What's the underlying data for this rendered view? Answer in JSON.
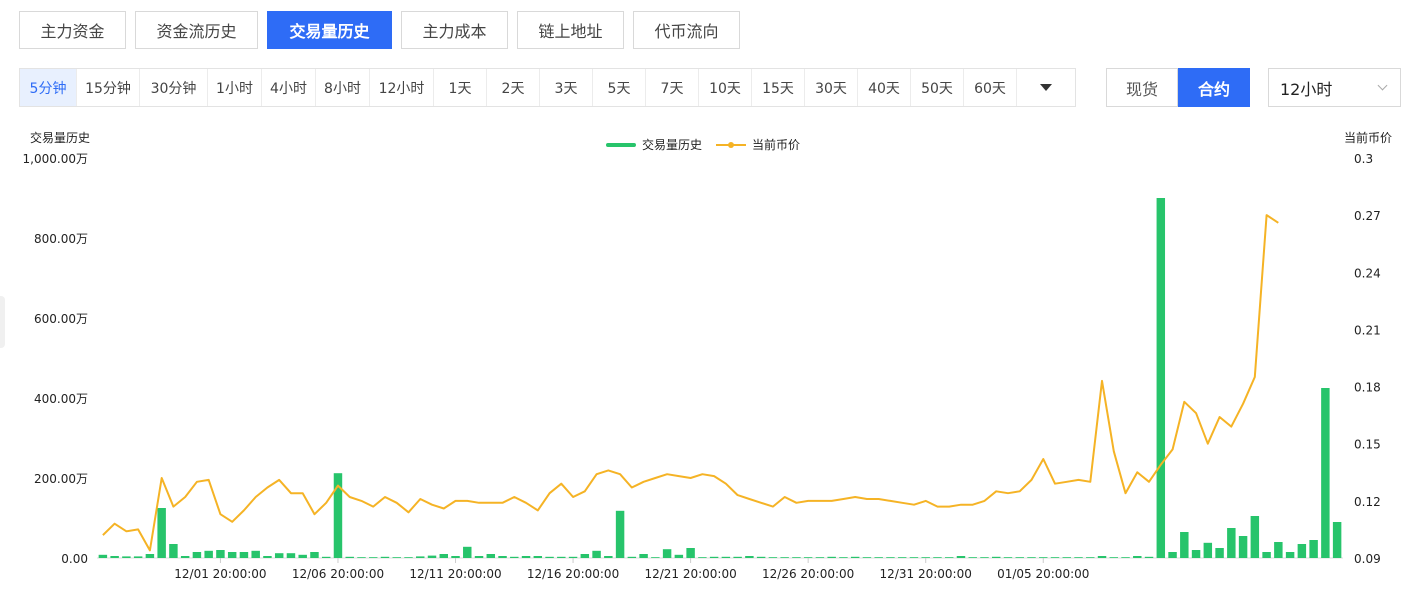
{
  "tabs": [
    "主力资金",
    "资金流历史",
    "交易量历史",
    "主力成本",
    "链上地址",
    "代币流向"
  ],
  "active_tab": 2,
  "intervals": [
    "5分钟",
    "15分钟",
    "30分钟",
    "1小时",
    "4小时",
    "8小时",
    "12小时",
    "1天",
    "2天",
    "3天",
    "5天",
    "7天",
    "10天",
    "15天",
    "30天",
    "40天",
    "50天",
    "60天"
  ],
  "active_interval": 0,
  "market": {
    "spot": "现货",
    "contract": "合约"
  },
  "period_select": "12小时",
  "accent": "#2e6cf6",
  "bar_color": "#27c46b",
  "line_color": "#f5b325",
  "chart_data": {
    "type": "bar+line",
    "ylabel_left": "交易量历史",
    "ylabel_right": "当前币价",
    "legend": [
      "交易量历史",
      "当前币价"
    ],
    "left_axis": {
      "range": [
        0,
        1000
      ],
      "ticks": [
        "0.00",
        "200.00万",
        "400.00万",
        "600.00万",
        "800.00万",
        "1,000.00万"
      ]
    },
    "right_axis": {
      "range": [
        0.09,
        0.3
      ],
      "ticks": [
        "0.09",
        "0.12",
        "0.15",
        "0.18",
        "0.21",
        "0.24",
        "0.27",
        "0.3"
      ]
    },
    "x_ticks": [
      "12/01 20:00:00",
      "12/06 20:00:00",
      "12/11 20:00:00",
      "12/16 20:00:00",
      "12/21 20:00:00",
      "12/26 20:00:00",
      "12/31 20:00:00",
      "01/05 20:00:00"
    ],
    "volume": [
      8,
      5,
      4,
      4,
      10,
      125,
      35,
      5,
      15,
      18,
      20,
      15,
      15,
      18,
      5,
      12,
      12,
      8,
      15,
      3,
      212,
      3,
      2,
      2,
      3,
      2,
      2,
      4,
      6,
      10,
      5,
      28,
      5,
      10,
      5,
      3,
      5,
      5,
      3,
      3,
      3,
      10,
      18,
      5,
      118,
      3,
      10,
      2,
      22,
      8,
      25,
      2,
      3,
      3,
      3,
      5,
      3,
      2,
      2,
      2,
      2,
      2,
      3,
      2,
      3,
      2,
      2,
      2,
      2,
      2,
      2,
      2,
      2,
      5,
      2,
      2,
      3,
      2,
      2,
      2,
      2,
      2,
      2,
      2,
      2,
      5,
      2,
      2,
      5,
      3,
      900,
      15,
      65,
      20,
      38,
      25,
      75,
      55,
      105,
      15,
      40,
      15,
      35,
      45,
      425,
      90
    ],
    "price": [
      0.102,
      0.108,
      0.104,
      0.105,
      0.094,
      0.132,
      0.117,
      0.122,
      0.13,
      0.131,
      0.113,
      0.109,
      0.115,
      0.122,
      0.127,
      0.131,
      0.124,
      0.124,
      0.113,
      0.119,
      0.128,
      0.122,
      0.12,
      0.117,
      0.122,
      0.119,
      0.114,
      0.121,
      0.118,
      0.116,
      0.12,
      0.12,
      0.119,
      0.119,
      0.119,
      0.122,
      0.119,
      0.115,
      0.124,
      0.129,
      0.122,
      0.125,
      0.134,
      0.136,
      0.134,
      0.127,
      0.13,
      0.132,
      0.134,
      0.133,
      0.132,
      0.134,
      0.133,
      0.129,
      0.123,
      0.121,
      0.119,
      0.117,
      0.122,
      0.119,
      0.12,
      0.12,
      0.12,
      0.121,
      0.122,
      0.121,
      0.121,
      0.12,
      0.119,
      0.118,
      0.12,
      0.117,
      0.117,
      0.118,
      0.118,
      0.12,
      0.125,
      0.124,
      0.125,
      0.131,
      0.142,
      0.129,
      0.13,
      0.131,
      0.13,
      0.183,
      0.146,
      0.124,
      0.135,
      0.13,
      0.139,
      0.147,
      0.172,
      0.166,
      0.15,
      0.164,
      0.159,
      0.171,
      0.185,
      0.27,
      0.266
    ]
  }
}
